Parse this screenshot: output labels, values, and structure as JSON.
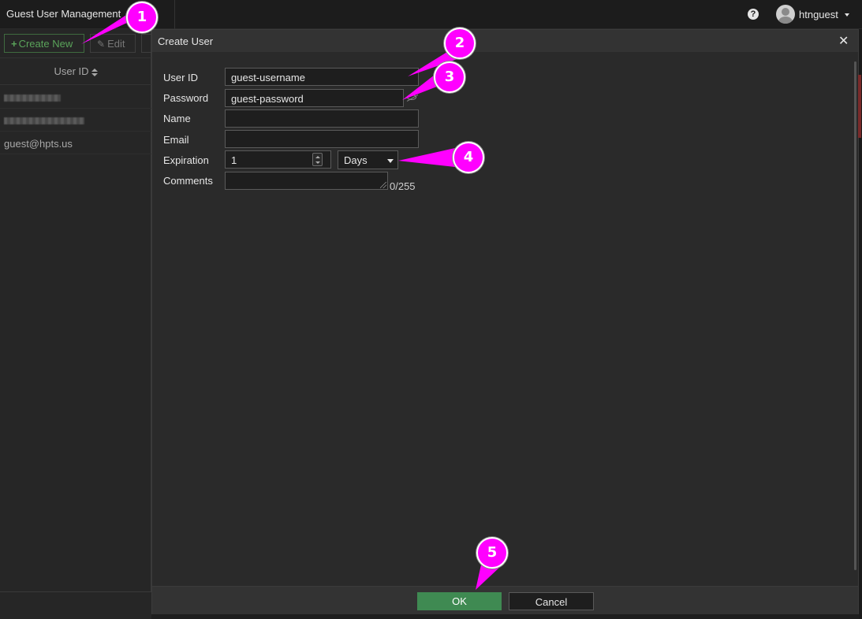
{
  "topbar": {
    "app_title": "Guest User Management",
    "help_icon": "question-circle-icon",
    "username": "htnguest"
  },
  "toolbar": {
    "create_label": "Create New",
    "edit_label": "Edit"
  },
  "table": {
    "column_header": "User ID",
    "rows": [
      "",
      "",
      "guest@hpts.us"
    ]
  },
  "dialog": {
    "title": "Create User",
    "fields": {
      "user_id": {
        "label": "User ID",
        "value": "guest-username"
      },
      "password": {
        "label": "Password",
        "value": "guest-password"
      },
      "name": {
        "label": "Name",
        "value": ""
      },
      "email": {
        "label": "Email",
        "value": ""
      },
      "expiration": {
        "label": "Expiration",
        "value": "1",
        "unit": "Days"
      },
      "comments": {
        "label": "Comments",
        "value": "",
        "char_count": "0/255"
      }
    },
    "ok_label": "OK",
    "cancel_label": "Cancel"
  },
  "annotations": [
    "1",
    "2",
    "3",
    "4",
    "5"
  ],
  "colors": {
    "annotation": "#ff00ff",
    "ok_button": "#3f8a52",
    "create_button": "#5aa35a"
  }
}
